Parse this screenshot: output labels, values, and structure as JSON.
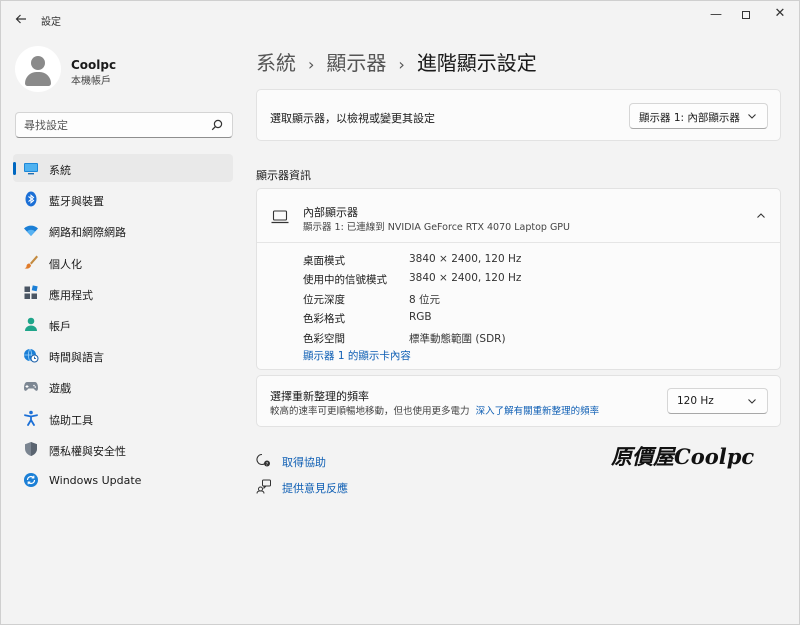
{
  "window": {
    "app_title": "設定",
    "controls": {
      "minimize": "—",
      "close": "✕"
    }
  },
  "profile": {
    "name": "Coolpc",
    "subtitle": "本機帳戶"
  },
  "search": {
    "placeholder": "尋找設定"
  },
  "nav": {
    "items": [
      {
        "label": "系統",
        "icon": "system-icon",
        "active": true
      },
      {
        "label": "藍牙與裝置",
        "icon": "bluetooth-icon"
      },
      {
        "label": "網路和網際網路",
        "icon": "wifi-icon"
      },
      {
        "label": "個人化",
        "icon": "brush-icon"
      },
      {
        "label": "應用程式",
        "icon": "apps-icon"
      },
      {
        "label": "帳戶",
        "icon": "account-icon"
      },
      {
        "label": "時間與語言",
        "icon": "globe-clock-icon"
      },
      {
        "label": "遊戲",
        "icon": "gamepad-icon"
      },
      {
        "label": "協助工具",
        "icon": "accessibility-icon"
      },
      {
        "label": "隱私權與安全性",
        "icon": "shield-icon"
      },
      {
        "label": "Windows Update",
        "icon": "update-icon"
      }
    ]
  },
  "breadcrumb": {
    "part1": "系統",
    "part2": "顯示器",
    "current": "進階顯示設定",
    "separator": "›"
  },
  "select_display": {
    "label": "選取顯示器，以檢視或變更其設定",
    "value": "顯示器 1: 內部顯示器"
  },
  "section_title": "顯示器資訊",
  "display_info": {
    "title": "內部顯示器",
    "subtitle": "顯示器 1: 已連線到 NVIDIA GeForce RTX 4070 Laptop GPU",
    "rows": [
      {
        "key": "桌面模式",
        "value": "3840 × 2400, 120 Hz"
      },
      {
        "key": "使用中的信號模式",
        "value": "3840 × 2400, 120 Hz"
      },
      {
        "key": "位元深度",
        "value": "8 位元"
      },
      {
        "key": "色彩格式",
        "value": "RGB"
      },
      {
        "key": "色彩空間",
        "value": "標準動態範圍 (SDR)"
      }
    ],
    "adapter_link": "顯示器 1 的顯示卡內容"
  },
  "refresh_rate": {
    "title": "選擇重新整理的頻率",
    "subtitle": "較高的速率可更順暢地移動，但也使用更多電力",
    "link": "深入了解有關重新整理的頻率",
    "value": "120 Hz"
  },
  "help": {
    "get_help": "取得協助",
    "feedback": "提供意見反應"
  },
  "watermark": {
    "text_cjk": "原價屋",
    "text_brand": "Coolpc"
  },
  "colors": {
    "accent": "#0067c0",
    "link": "#0f5fb4",
    "background": "#f3f3f3",
    "card": "#fbfbfb"
  }
}
